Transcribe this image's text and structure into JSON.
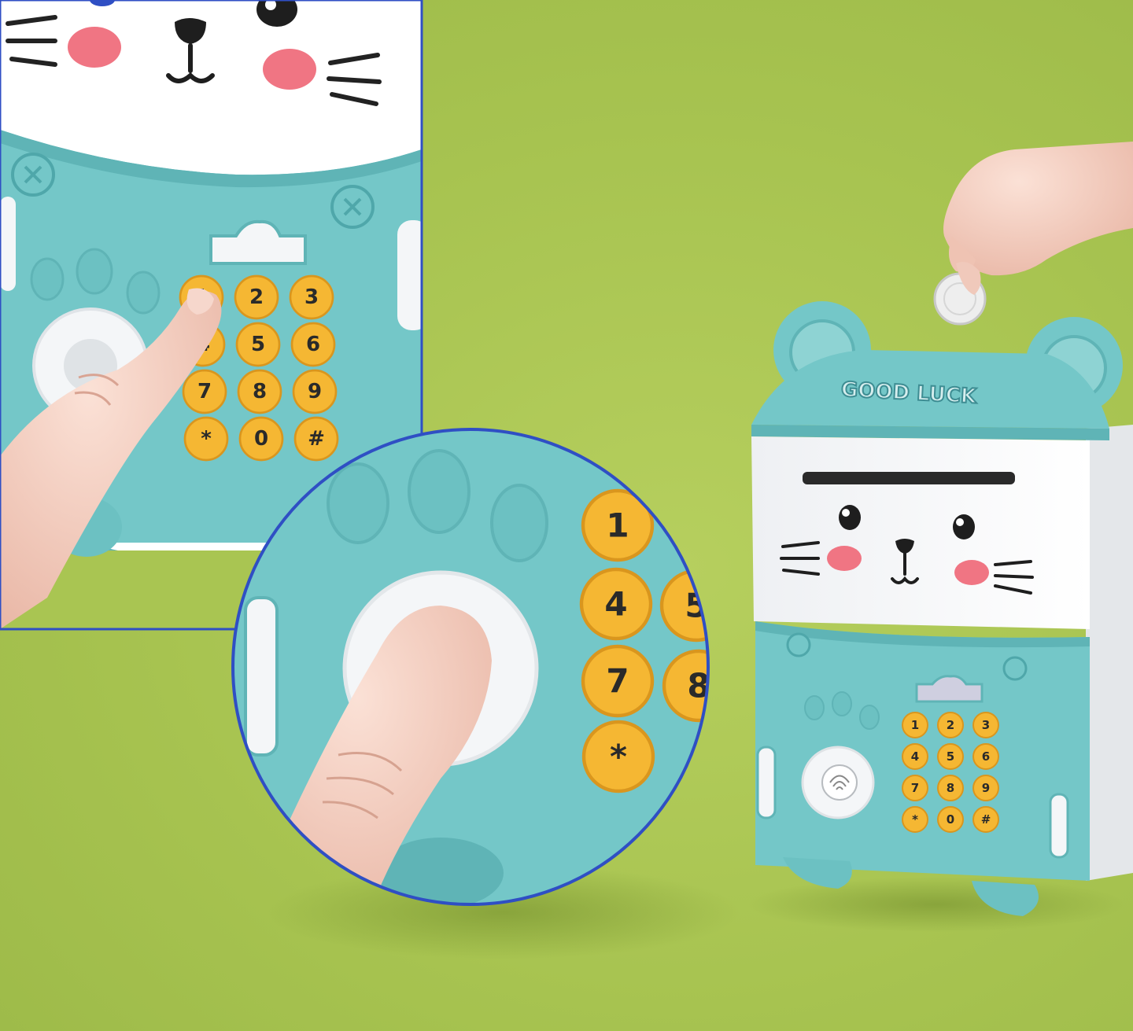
{
  "colors": {
    "background": "#a9c552",
    "teal_body": "#73c6c7",
    "teal_dark": "#4fa7aa",
    "white_panel": "#f4f6f8",
    "button_yellow": "#f5b733",
    "cheek_pink": "#f07583",
    "inset_border": "#2f4fc4"
  },
  "product": {
    "logo_text": "GOOD LUCK"
  },
  "keypad": {
    "keys": [
      "1",
      "2",
      "3",
      "4",
      "5",
      "6",
      "7",
      "8",
      "9",
      "*",
      "0",
      "#"
    ]
  },
  "zoom_keys": [
    "1",
    "4",
    "7",
    "*",
    "5",
    "8"
  ]
}
